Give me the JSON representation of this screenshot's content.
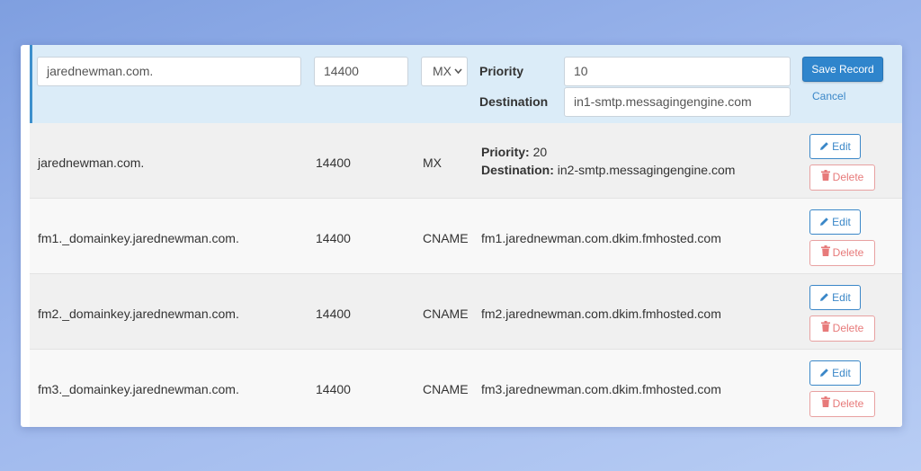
{
  "edit_form": {
    "name_value": "jarednewman.com.",
    "ttl_value": "14400",
    "type_value": "MX",
    "priority_label": "Priority",
    "priority_value": "10",
    "destination_label": "Destination",
    "destination_value": "in1-smtp.messagingengine.com",
    "save_label": "Save Record",
    "cancel_label": "Cancel"
  },
  "records": [
    {
      "name": "jarednewman.com.",
      "ttl": "14400",
      "type": "MX",
      "priority_label": "Priority:",
      "priority": "20",
      "destination_label": "Destination:",
      "destination": "in2-smtp.messagingengine.com"
    },
    {
      "name": "fm1._domainkey.jarednewman.com.",
      "ttl": "14400",
      "type": "CNAME",
      "record": "fm1.jarednewman.com.dkim.fmhosted.com"
    },
    {
      "name": "fm2._domainkey.jarednewman.com.",
      "ttl": "14400",
      "type": "CNAME",
      "record": "fm2.jarednewman.com.dkim.fmhosted.com"
    },
    {
      "name": "fm3._domainkey.jarednewman.com.",
      "ttl": "14400",
      "type": "CNAME",
      "record": "fm3.jarednewman.com.dkim.fmhosted.com"
    }
  ],
  "actions": {
    "edit_label": "Edit",
    "delete_label": "Delete"
  },
  "icons": {
    "edit": "pencil-icon",
    "delete": "trash-icon",
    "select": "chevron-down-icon"
  },
  "colors": {
    "accent": "#2f85cc",
    "danger": "#e77a7a",
    "edit_row_bg": "#dbecf8"
  }
}
